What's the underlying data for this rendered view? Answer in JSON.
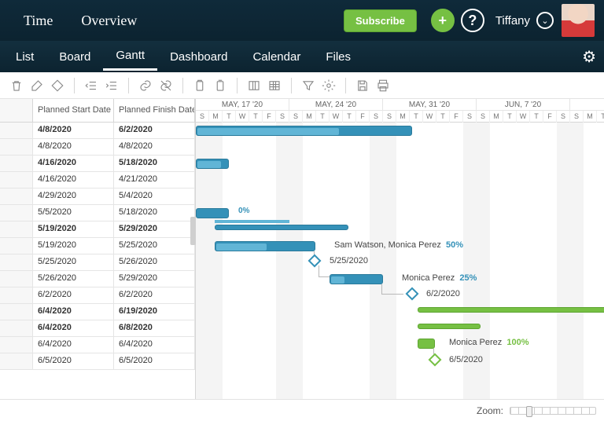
{
  "header": {
    "nav": [
      "Time",
      "Overview"
    ],
    "subscribe": "Subscribe",
    "username": "Tiffany"
  },
  "tabs": [
    "List",
    "Board",
    "Gantt",
    "Dashboard",
    "Calendar",
    "Files"
  ],
  "active_tab": 2,
  "columns": [
    "Planned Start Date",
    "Planned Finish Date"
  ],
  "rows": [
    {
      "start": "4/8/2020",
      "finish": "6/2/2020",
      "bold": true
    },
    {
      "start": "4/8/2020",
      "finish": "4/8/2020",
      "bold": false
    },
    {
      "start": "4/16/2020",
      "finish": "5/18/2020",
      "bold": true
    },
    {
      "start": "4/16/2020",
      "finish": "4/21/2020",
      "bold": false
    },
    {
      "start": "4/29/2020",
      "finish": "5/4/2020",
      "bold": false
    },
    {
      "start": "5/5/2020",
      "finish": "5/18/2020",
      "bold": false
    },
    {
      "start": "5/19/2020",
      "finish": "5/29/2020",
      "bold": true
    },
    {
      "start": "5/19/2020",
      "finish": "5/25/2020",
      "bold": false
    },
    {
      "start": "5/25/2020",
      "finish": "5/26/2020",
      "bold": false
    },
    {
      "start": "5/26/2020",
      "finish": "5/29/2020",
      "bold": false
    },
    {
      "start": "6/2/2020",
      "finish": "6/2/2020",
      "bold": false
    },
    {
      "start": "6/4/2020",
      "finish": "6/19/2020",
      "bold": true
    },
    {
      "start": "6/4/2020",
      "finish": "6/8/2020",
      "bold": true
    },
    {
      "start": "6/4/2020",
      "finish": "6/4/2020",
      "bold": false
    },
    {
      "start": "6/5/2020",
      "finish": "6/5/2020",
      "bold": false
    }
  ],
  "timeline": {
    "weeks": [
      "MAY, 17 '20",
      "MAY, 24 '20",
      "MAY, 31 '20",
      "JUN, 7 '20",
      "JUN,"
    ],
    "day_letters": [
      "S",
      "M",
      "T",
      "W",
      "T",
      "F",
      "S"
    ]
  },
  "bars": {
    "r5_pct": "0%",
    "r7_label": "Sam Watson, Monica Perez",
    "r7_pct": "50%",
    "r8_date": "5/25/2020",
    "r9_label": "Monica Perez",
    "r9_pct": "25%",
    "r10_date": "6/2/2020",
    "r13_label": "Monica Perez",
    "r13_pct": "100%",
    "r14_date": "6/5/2020"
  },
  "footer": {
    "zoom": "Zoom:"
  }
}
